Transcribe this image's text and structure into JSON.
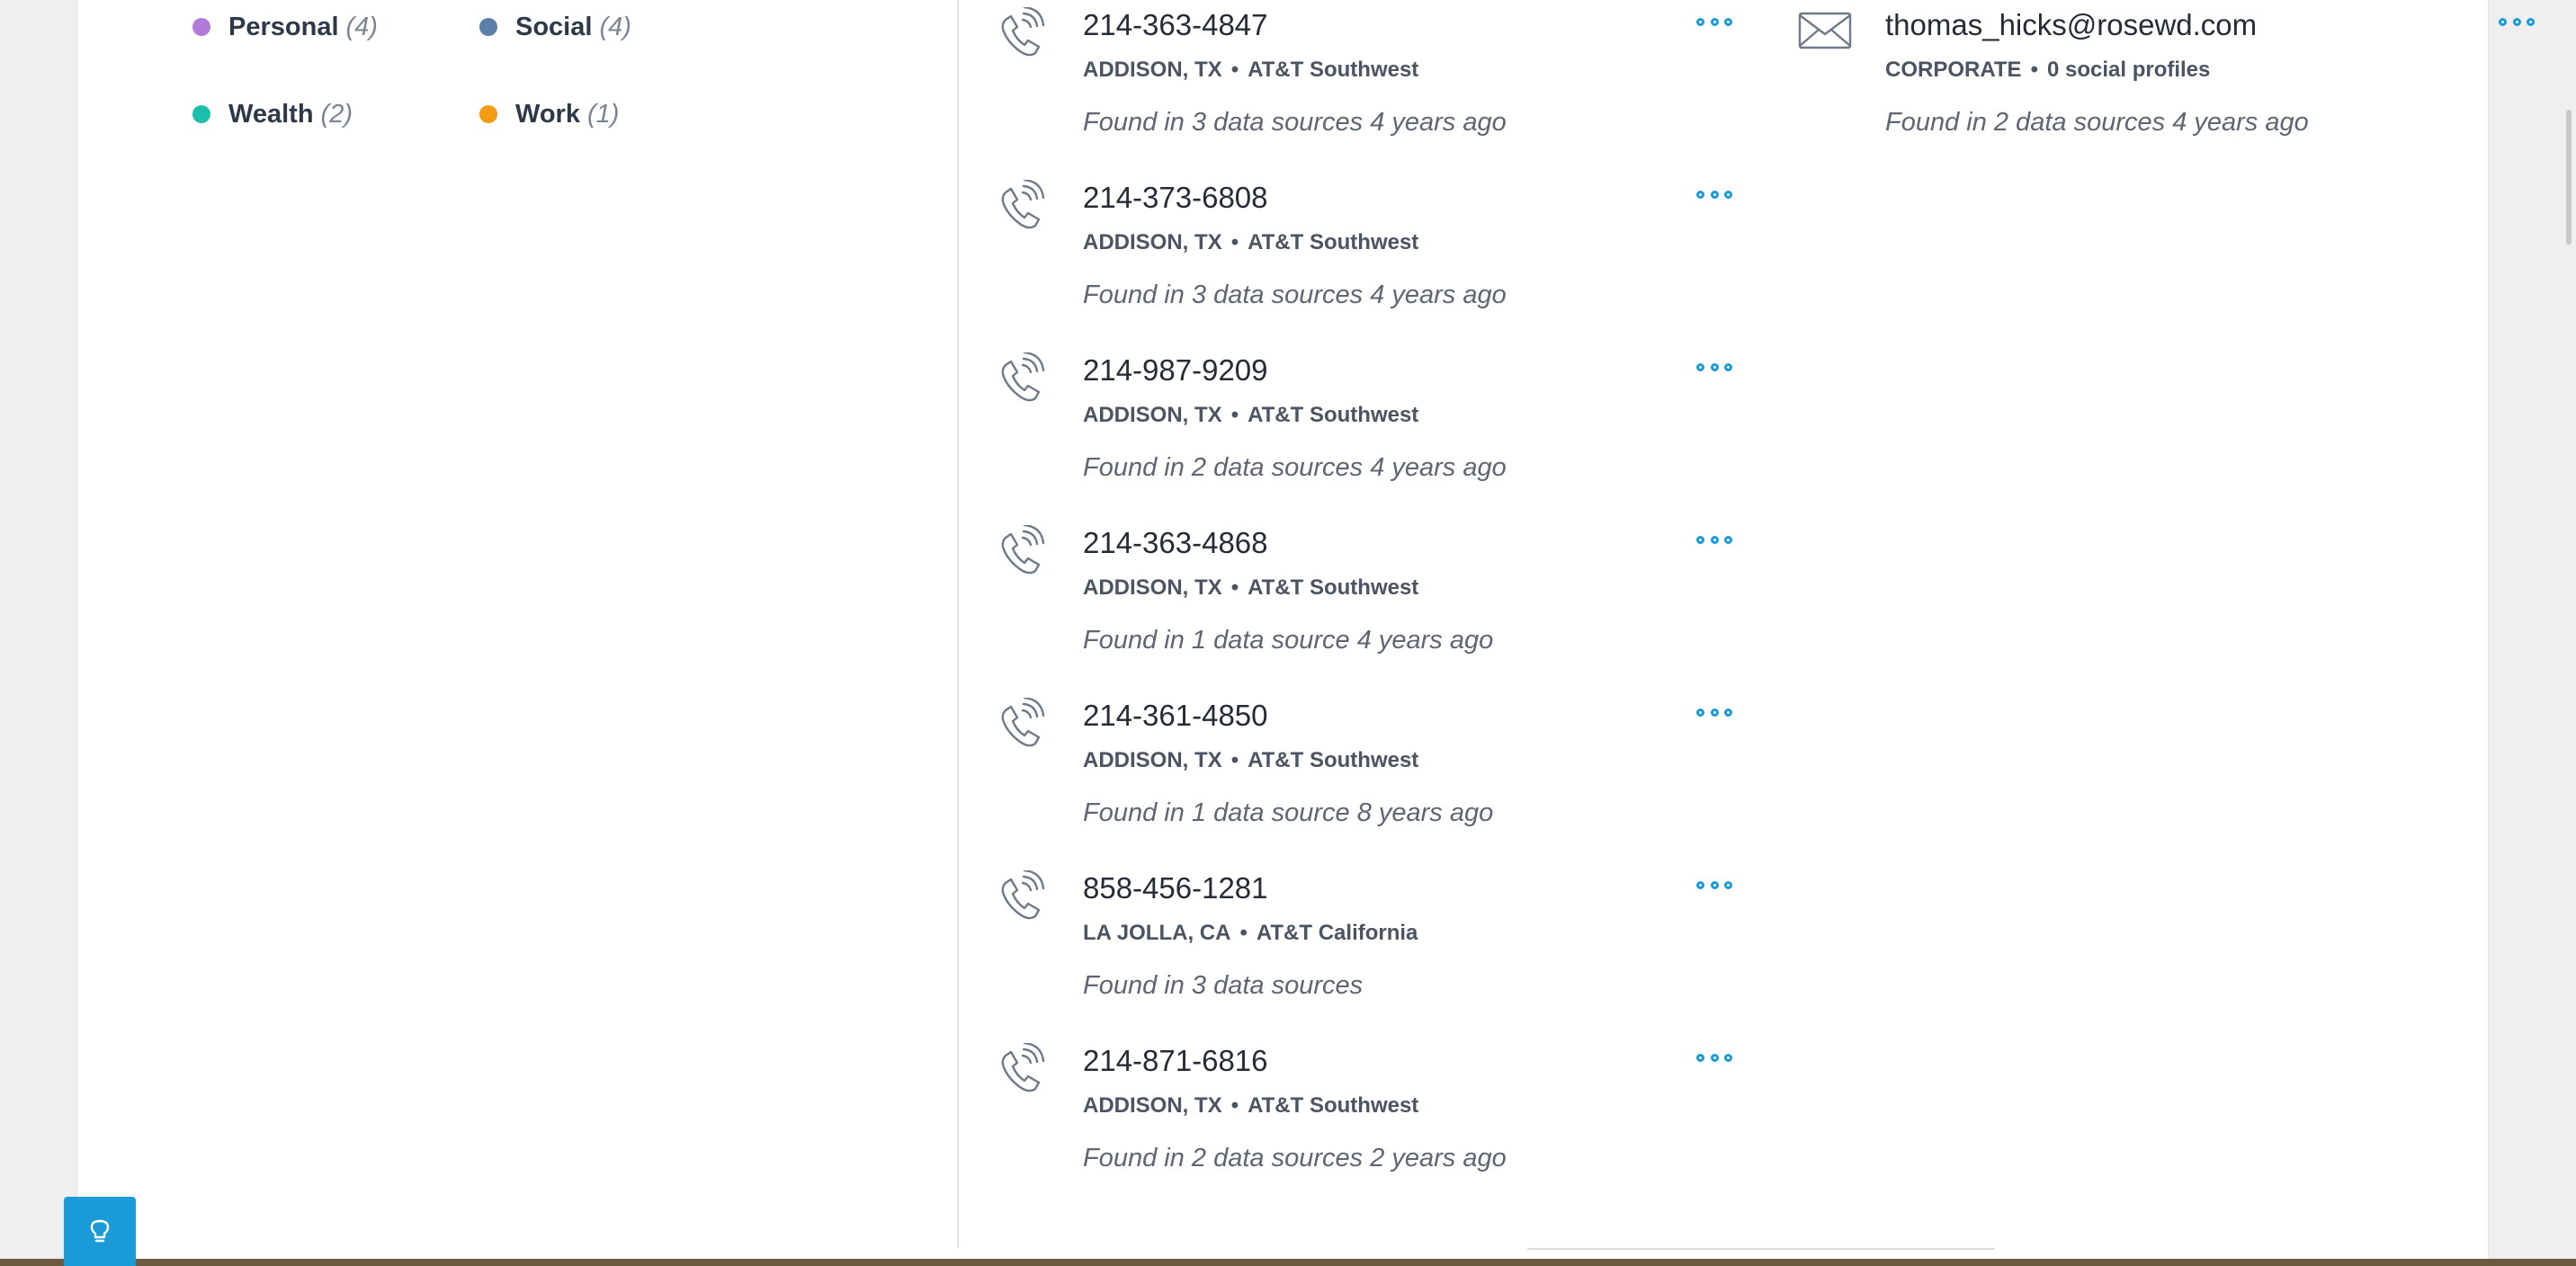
{
  "legend": [
    {
      "label": "Personal",
      "count": "(4)",
      "color": "#b27ad9"
    },
    {
      "label": "Social",
      "count": "(4)",
      "color": "#5b7fa6"
    },
    {
      "label": "Wealth",
      "count": "(2)",
      "color": "#1cbfab"
    },
    {
      "label": "Work",
      "count": "(1)",
      "color": "#f39c12"
    }
  ],
  "phones": [
    {
      "number": "214-363-4847",
      "location": "ADDISON, TX",
      "carrier": "AT&T Southwest",
      "found": "Found in 3 data sources 4 years ago"
    },
    {
      "number": "214-373-6808",
      "location": "ADDISON, TX",
      "carrier": "AT&T Southwest",
      "found": "Found in 3 data sources 4 years ago"
    },
    {
      "number": "214-987-9209",
      "location": "ADDISON, TX",
      "carrier": "AT&T Southwest",
      "found": "Found in 2 data sources 4 years ago"
    },
    {
      "number": "214-363-4868",
      "location": "ADDISON, TX",
      "carrier": "AT&T Southwest",
      "found": "Found in 1 data source 4 years ago"
    },
    {
      "number": "214-361-4850",
      "location": "ADDISON, TX",
      "carrier": "AT&T Southwest",
      "found": "Found in 1 data source 8 years ago"
    },
    {
      "number": "858-456-1281",
      "location": "LA JOLLA, CA",
      "carrier": "AT&T California",
      "found": "Found in 3 data sources"
    },
    {
      "number": "214-871-6816",
      "location": "ADDISON, TX",
      "carrier": "AT&T Southwest",
      "found": "Found in 2 data sources 2 years ago"
    }
  ],
  "email": {
    "address": "thomas_hicks@rosewd.com",
    "type": "CORPORATE",
    "profiles": "0 social profiles",
    "found": "Found in 2 data sources 4 years ago"
  },
  "icons": {
    "phone": "phone-icon",
    "email": "envelope-icon",
    "more": "more-options-icon",
    "help": "lightbulb-icon"
  },
  "colors": {
    "accent": "#1a9bd7",
    "separator": "•"
  }
}
